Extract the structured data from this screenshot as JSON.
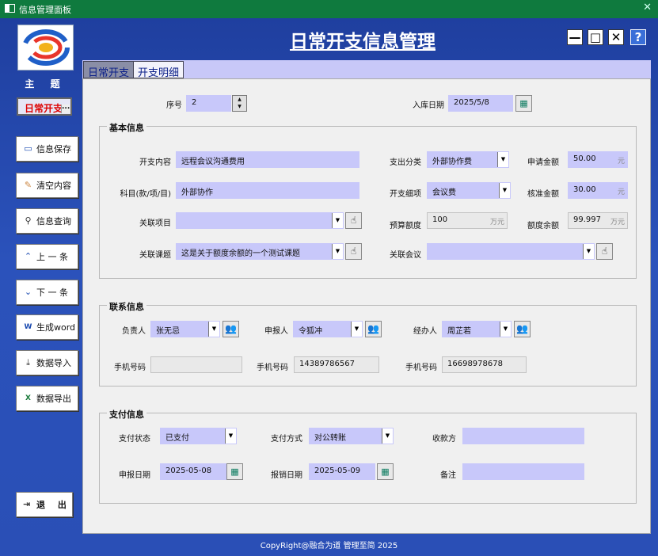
{
  "window": {
    "title": "信息管理面板",
    "close_label": "✕"
  },
  "app": {
    "title": "日常开支信息管理",
    "theme_label": "主 题",
    "theme_value": "日常开支",
    "theme_dots": "..."
  },
  "window_buttons": {
    "minimize": "—",
    "maximize": "□",
    "close": "✕",
    "help": "?"
  },
  "sidebar": {
    "items": [
      {
        "label": "信息保存"
      },
      {
        "label": "清空内容"
      },
      {
        "label": "信息查询"
      },
      {
        "label": "上 一 条"
      },
      {
        "label": "下 一 条"
      },
      {
        "label": "生成word"
      },
      {
        "label": "数据导入"
      },
      {
        "label": "数据导出"
      }
    ],
    "exit_label": "退 出"
  },
  "tabs": [
    {
      "label": "日常开支"
    },
    {
      "label": "开支明细"
    }
  ],
  "form": {
    "seq_label": "序号",
    "seq_value": "2",
    "stock_date_label": "入库日期",
    "stock_date_value": "2025/5/8",
    "basic": {
      "title": "基本信息",
      "content_label": "开支内容",
      "content_value": "远程会议沟通费用",
      "category_label": "支出分类",
      "category_value": "外部协作费",
      "apply_amount_label": "申请金额",
      "apply_amount_value": "50.00",
      "apply_amount_unit": "元",
      "subject_label": "科目(款/项/目)",
      "subject_value": "外部协作",
      "detail_label": "开支细项",
      "detail_value": "会议费",
      "approved_amount_label": "核准金额",
      "approved_amount_value": "30.00",
      "approved_amount_unit": "元",
      "project_label": "关联项目",
      "project_value": "",
      "budget_label": "预算额度",
      "budget_value": "100",
      "budget_unit": "万元",
      "balance_label": "额度余额",
      "balance_value": "99.997",
      "balance_unit": "万元",
      "topic_label": "关联课题",
      "topic_value": "这是关于额度余额的一个测试课题",
      "meeting_label": "关联会议",
      "meeting_value": ""
    },
    "contact": {
      "title": "联系信息",
      "owner_label": "负责人",
      "owner_value": "张无忌",
      "reporter_label": "申报人",
      "reporter_value": "令狐冲",
      "handler_label": "经办人",
      "handler_value": "周芷若",
      "phone_label": "手机号码",
      "owner_phone": "",
      "reporter_phone": "14389786567",
      "handler_phone": "16698978678"
    },
    "payment": {
      "title": "支付信息",
      "status_label": "支付状态",
      "status_value": "已支付",
      "method_label": "支付方式",
      "method_value": "对公转账",
      "payee_label": "收款方",
      "payee_value": "",
      "report_date_label": "申报日期",
      "report_date_value": "2025-05-08",
      "reimburse_date_label": "报销日期",
      "reimburse_date_value": "2025-05-09",
      "note_label": "备注",
      "note_value": ""
    }
  },
  "footer": {
    "text": "CopyRight@融合为道 管理至简 2025"
  },
  "colors": {
    "titlebar": "#0f7a3e",
    "app_bg": "#2a4fb6",
    "input": "#c8c8fa",
    "tab_strip": "#c8c8f8"
  }
}
